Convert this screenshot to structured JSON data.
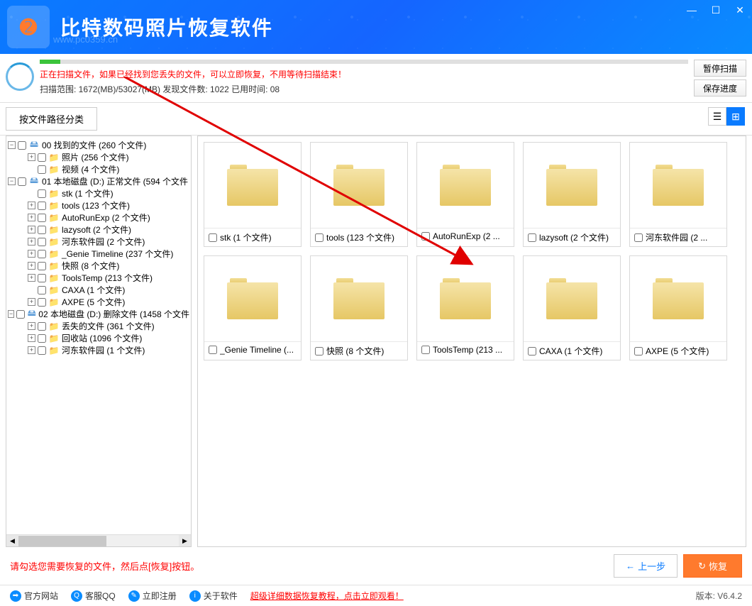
{
  "app": {
    "title": "比特数码照片恢复软件",
    "watermark": "www.pc0359.cn",
    "logo_text": "➋"
  },
  "win": {
    "min": "—",
    "max": "☐",
    "close": "✕"
  },
  "scan": {
    "msg": "正在扫描文件，如果已经找到您丢失的文件，可以立即恢复，不用等待扫描结束！",
    "stats": "扫描范围: 1672(MB)/53027(MB)    发现文件数: 1022    已用时间: 08",
    "pause": "暂停扫描",
    "save": "保存进度"
  },
  "filter": {
    "tab": "按文件路径分类"
  },
  "tree": [
    {
      "lvl": 0,
      "exp": "−",
      "ico": "drive",
      "label": "00 找到的文件  (260 个文件)"
    },
    {
      "lvl": 1,
      "exp": "+",
      "ico": "folder",
      "label": "照片    (256 个文件)"
    },
    {
      "lvl": 1,
      "exp": "",
      "ico": "folder",
      "label": "视频    (4 个文件)"
    },
    {
      "lvl": 0,
      "exp": "−",
      "ico": "drive",
      "label": "01 本地磁盘 (D:) 正常文件 (594 个文件"
    },
    {
      "lvl": 1,
      "exp": "",
      "ico": "folder",
      "label": "stk    (1 个文件)"
    },
    {
      "lvl": 1,
      "exp": "+",
      "ico": "folder",
      "label": "tools    (123 个文件)"
    },
    {
      "lvl": 1,
      "exp": "+",
      "ico": "folder",
      "label": "AutoRunExp    (2 个文件)"
    },
    {
      "lvl": 1,
      "exp": "+",
      "ico": "folder",
      "label": "lazysoft    (2 个文件)"
    },
    {
      "lvl": 1,
      "exp": "+",
      "ico": "folder",
      "label": "河东软件园    (2 个文件)"
    },
    {
      "lvl": 1,
      "exp": "+",
      "ico": "folder",
      "label": "_Genie Timeline    (237 个文件)"
    },
    {
      "lvl": 1,
      "exp": "+",
      "ico": "folder",
      "label": "快照    (8 个文件)"
    },
    {
      "lvl": 1,
      "exp": "+",
      "ico": "folder",
      "label": "ToolsTemp    (213 个文件)"
    },
    {
      "lvl": 1,
      "exp": "",
      "ico": "folder",
      "label": "CAXA    (1 个文件)"
    },
    {
      "lvl": 1,
      "exp": "+",
      "ico": "folder",
      "label": "AXPE    (5 个文件)"
    },
    {
      "lvl": 0,
      "exp": "−",
      "ico": "drive",
      "label": "02 本地磁盘 (D:) 删除文件 (1458 个文件"
    },
    {
      "lvl": 1,
      "exp": "+",
      "ico": "folder",
      "label": "丢失的文件    (361 个文件)"
    },
    {
      "lvl": 1,
      "exp": "+",
      "ico": "folder",
      "label": "回收站    (1096 个文件)"
    },
    {
      "lvl": 1,
      "exp": "+",
      "ico": "folder",
      "label": "河东软件园    (1 个文件)"
    }
  ],
  "grid": [
    {
      "label": "stk  (1 个文件)"
    },
    {
      "label": "tools  (123 个文件)"
    },
    {
      "label": "AutoRunExp  (2 ..."
    },
    {
      "label": "lazysoft  (2 个文件)"
    },
    {
      "label": "河东软件园  (2 ..."
    },
    {
      "label": "_Genie Timeline  (..."
    },
    {
      "label": "快照  (8 个文件)"
    },
    {
      "label": "ToolsTemp  (213 ..."
    },
    {
      "label": "CAXA  (1 个文件)"
    },
    {
      "label": "AXPE  (5 个文件)"
    }
  ],
  "hint": "请勾选您需要恢复的文件，然后点[恢复]按钮。",
  "nav": {
    "prev": "上一步",
    "recover": "恢复"
  },
  "bottom": {
    "site": "官方网站",
    "qq": "客服QQ",
    "reg": "立即注册",
    "about": "关于软件",
    "tutorial": "超级详细数据恢复教程，点击立即观看！",
    "version": "版本: V6.4.2"
  }
}
